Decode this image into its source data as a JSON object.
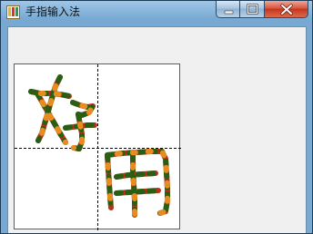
{
  "window": {
    "title": "手指输入法",
    "app_icon": "app-icon",
    "controls": {
      "minimize_icon": "minimize-icon",
      "maximize_icon": "maximize-icon",
      "close_icon": "close-icon"
    }
  },
  "pad": {
    "grid": "2x2 dashed",
    "handwritten_characters": [
      "好",
      "用"
    ],
    "stroke_colors": [
      "#dd3a1f",
      "#2a5e12",
      "#e98c1f"
    ]
  }
}
